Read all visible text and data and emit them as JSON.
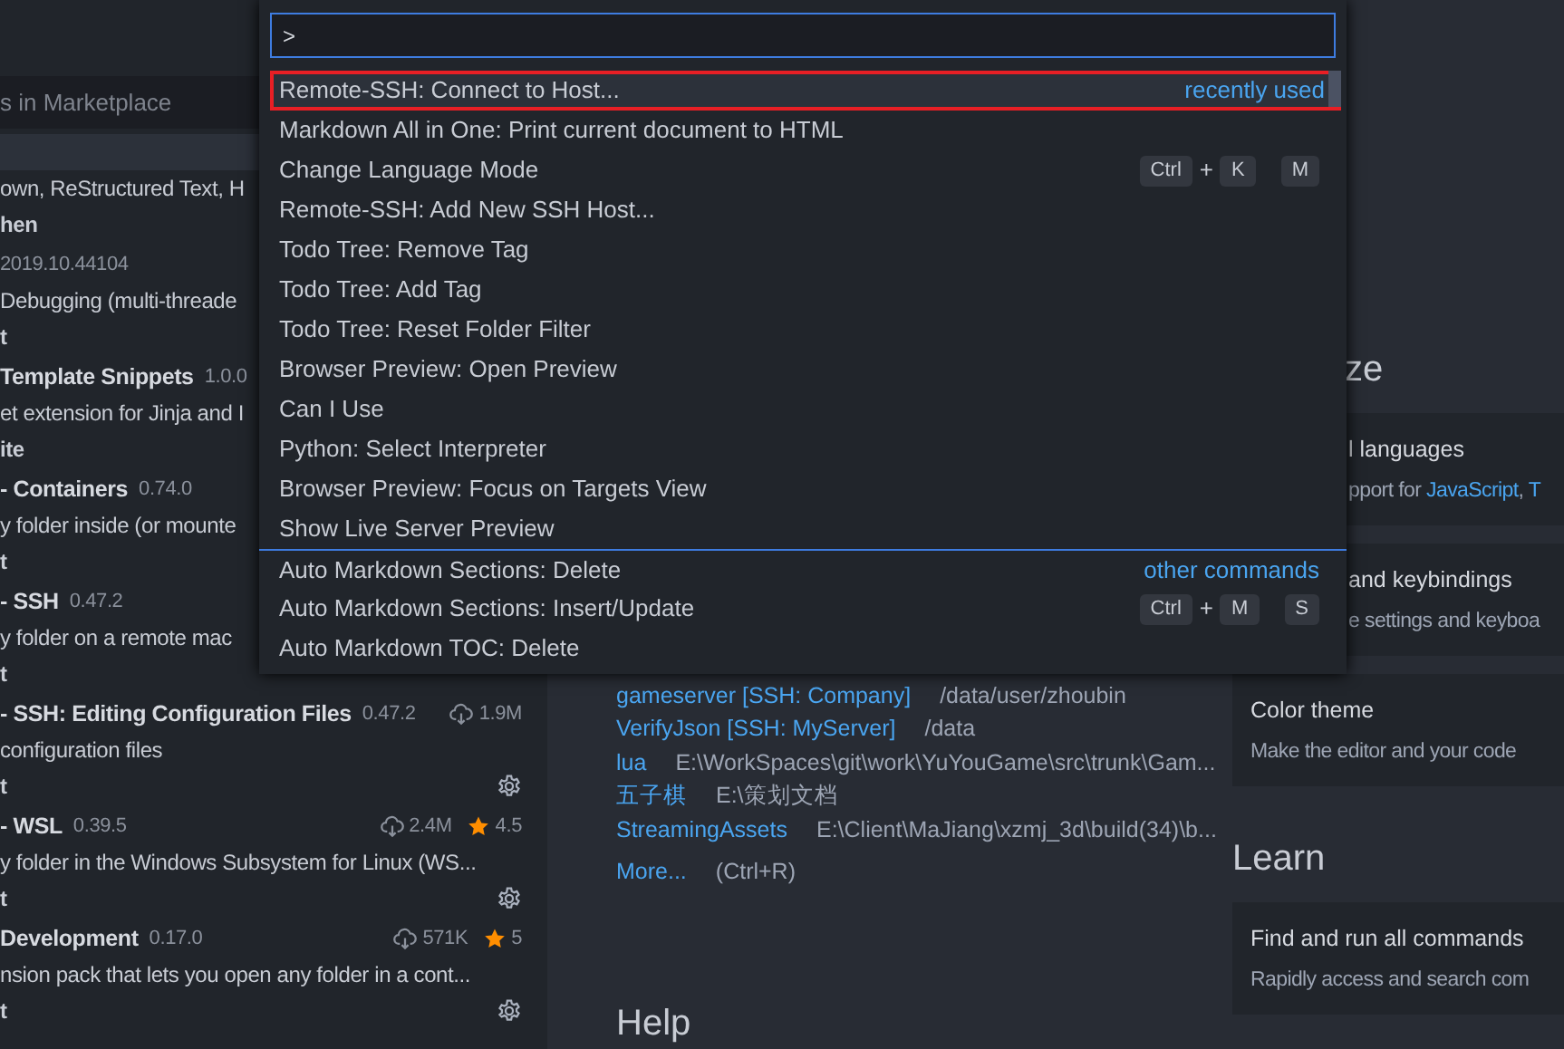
{
  "sidebar": {
    "search": {
      "placeholder": "s in Marketplace"
    },
    "extensions": [
      {
        "description": "own, ReStructured Text, H",
        "author": "hen",
        "selected": true
      },
      {
        "version": "2019.10.44104",
        "description": "Debugging (multi-threade",
        "author": "t",
        "selected": false
      },
      {
        "name": "Template Snippets",
        "version": "1.0.0",
        "description": "et extension for Jinja and I",
        "author": "ite",
        "selected": false
      },
      {
        "name": "- Containers",
        "version": "0.74.0",
        "description": "y folder inside (or mounte",
        "author": "t",
        "selected": false
      },
      {
        "name": "- SSH",
        "version": "0.47.2",
        "description": "y folder on a remote mac",
        "author": "t",
        "selected": false
      },
      {
        "name": "- SSH: Editing Configuration Files",
        "version": "0.47.2",
        "description": "configuration files",
        "author": "t",
        "downloads": "1.9M",
        "gear": true,
        "selected": false
      },
      {
        "name": "- WSL",
        "version": "0.39.5",
        "description": "y folder in the Windows Subsystem for Linux (WS...",
        "author": "t",
        "downloads": "2.4M",
        "rating": "4.5",
        "gear": true,
        "selected": false
      },
      {
        "name": "Development",
        "version": "0.17.0",
        "description": "nsion pack that lets you open any folder in a cont...",
        "author": "t",
        "downloads": "571K",
        "rating": "5",
        "gear": true,
        "selected": false
      }
    ]
  },
  "welcome": {
    "recent": [
      {
        "name": "gameserver [SSH: Company]",
        "path": "/data/user/zhoubin"
      },
      {
        "name": "VerifyJson [SSH: MyServer]",
        "path": "/data"
      },
      {
        "name": "lua",
        "path": "E:\\WorkSpaces\\git\\work\\YuYouGame\\src\\trunk\\Gam..."
      },
      {
        "name": "五子棋",
        "path": "E:\\策划文档"
      },
      {
        "name": "StreamingAssets",
        "path": "E:\\Client\\MaJiang\\xzmj_3d\\build(34)\\b..."
      }
    ],
    "more": {
      "link": "More...",
      "shortcut": "(Ctrl+R)"
    },
    "help_heading": "Help",
    "customize_heading": "ze",
    "customize_cards": [
      {
        "title": "l languages",
        "description": [
          {
            "text": "pport for ",
            "kind": "text"
          },
          {
            "text": "JavaScript",
            "kind": "link"
          },
          {
            "text": ", ",
            "kind": "text"
          },
          {
            "text": "T",
            "kind": "link"
          }
        ]
      },
      {
        "title": "and keybindings",
        "description": [
          {
            "text": "e settings and keyboa",
            "kind": "text"
          }
        ]
      },
      {
        "title": "Color theme",
        "description": [
          {
            "text": "Make the editor and your code",
            "kind": "text"
          }
        ]
      }
    ],
    "learn_heading": "Learn",
    "learn_cards": [
      {
        "title": "Find and run all commands",
        "description": [
          {
            "text": "Rapidly access and search com",
            "kind": "text"
          }
        ]
      }
    ]
  },
  "palette": {
    "input": {
      "value": ">"
    },
    "commands": [
      {
        "label": "Remote-SSH: Connect to Host...",
        "detail": "recently used",
        "selected": true,
        "highlighted": true,
        "separator_before": false
      },
      {
        "label": "Markdown All in One: Print current document to HTML",
        "selected": false,
        "highlighted": false,
        "separator_before": false
      },
      {
        "label": "Change Language Mode",
        "keys": [
          {
            "kind": "key",
            "text": "Ctrl"
          },
          {
            "kind": "plus",
            "text": "+"
          },
          {
            "kind": "key",
            "text": "K"
          },
          {
            "kind": "gap"
          },
          {
            "kind": "key",
            "text": "M"
          }
        ],
        "selected": false,
        "highlighted": false,
        "separator_before": false
      },
      {
        "label": "Remote-SSH: Add New SSH Host...",
        "selected": false,
        "highlighted": false,
        "separator_before": false
      },
      {
        "label": "Todo Tree: Remove Tag",
        "selected": false,
        "highlighted": false,
        "separator_before": false
      },
      {
        "label": "Todo Tree: Add Tag",
        "selected": false,
        "highlighted": false,
        "separator_before": false
      },
      {
        "label": "Todo Tree: Reset Folder Filter",
        "selected": false,
        "highlighted": false,
        "separator_before": false
      },
      {
        "label": "Browser Preview: Open Preview",
        "selected": false,
        "highlighted": false,
        "separator_before": false
      },
      {
        "label": "Can I Use",
        "selected": false,
        "highlighted": false,
        "separator_before": false
      },
      {
        "label": "Python: Select Interpreter",
        "selected": false,
        "highlighted": false,
        "separator_before": false
      },
      {
        "label": "Browser Preview: Focus on Targets View",
        "selected": false,
        "highlighted": false,
        "separator_before": false
      },
      {
        "label": "Show Live Server Preview",
        "selected": false,
        "highlighted": false,
        "separator_before": false
      },
      {
        "label": "Auto Markdown Sections: Delete",
        "detail": "other commands",
        "selected": false,
        "highlighted": false,
        "separator_before": true
      },
      {
        "label": "Auto Markdown Sections: Insert/Update",
        "keys": [
          {
            "kind": "key",
            "text": "Ctrl"
          },
          {
            "kind": "plus",
            "text": "+"
          },
          {
            "kind": "key",
            "text": "M"
          },
          {
            "kind": "gap"
          },
          {
            "kind": "key",
            "text": "S"
          }
        ],
        "selected": false,
        "highlighted": false,
        "separator_before": false
      },
      {
        "label": "Auto Markdown TOC: Delete",
        "selected": false,
        "highlighted": false,
        "separator_before": false
      }
    ]
  }
}
